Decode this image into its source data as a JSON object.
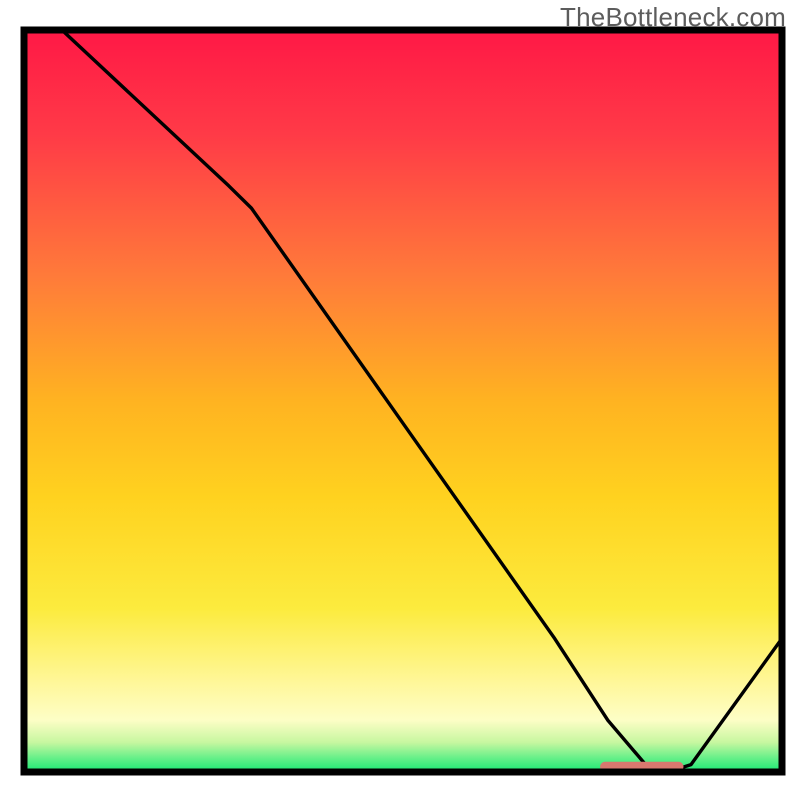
{
  "watermark": "TheBottleneck.com",
  "chart_data": {
    "type": "line",
    "title": "",
    "xlabel": "",
    "ylabel": "",
    "xlim": [
      0,
      100
    ],
    "ylim": [
      0,
      100
    ],
    "x": [
      0,
      5,
      27,
      30,
      50,
      70,
      77,
      82,
      85,
      88,
      100
    ],
    "values": [
      105,
      100,
      79,
      76,
      47,
      18,
      7,
      1,
      0,
      1,
      18
    ],
    "marker": {
      "x_start": 76,
      "x_end": 87,
      "y": 0.7
    },
    "grid": false,
    "legend": false,
    "background": "red-yellow-green vertical heat gradient",
    "annotations": []
  },
  "colors": {
    "gradient_top": "#ff1846",
    "gradient_mid_upper": "#ff7a3a",
    "gradient_mid": "#ffd21f",
    "gradient_lower": "#fff79a",
    "gradient_bottom": "#17e873",
    "curve": "#000000",
    "marker": "#d9786f",
    "frame": "#000000"
  }
}
